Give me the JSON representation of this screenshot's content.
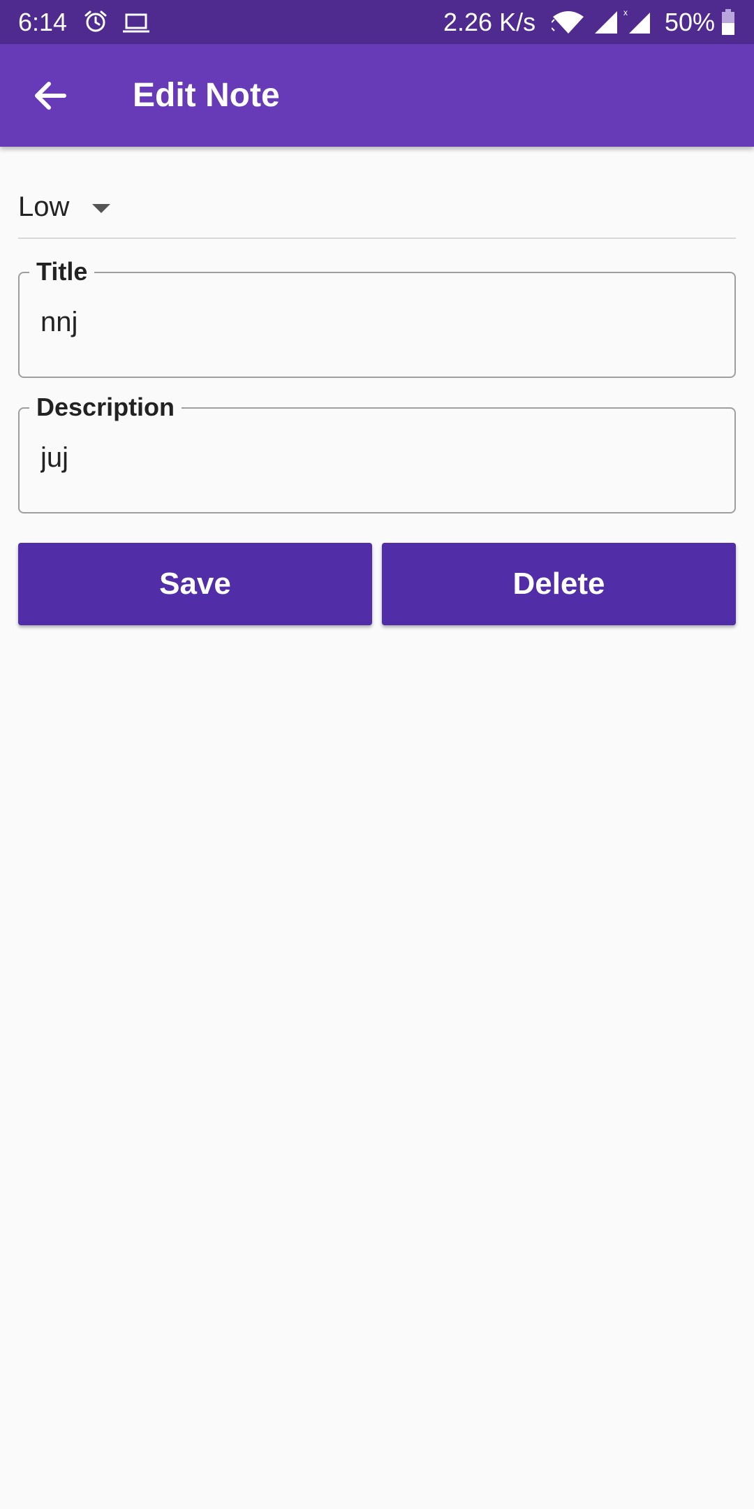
{
  "status_bar": {
    "time": "6:14",
    "net_speed": "2.26 K/s",
    "battery": "50%",
    "icons": [
      "alarm-icon",
      "laptop-icon",
      "wifi-icon",
      "signal-icon",
      "battery-icon"
    ]
  },
  "app_bar": {
    "title": "Edit Note",
    "back_icon": "arrow-back-icon",
    "background_color": "#673ab7"
  },
  "form": {
    "priority": {
      "selected": "Low"
    },
    "title_field": {
      "label": "Title",
      "value": "nnj"
    },
    "description_field": {
      "label": "Description",
      "value": "juj"
    },
    "buttons": {
      "save_label": "Save",
      "delete_label": "Delete",
      "color": "#512da8"
    }
  }
}
